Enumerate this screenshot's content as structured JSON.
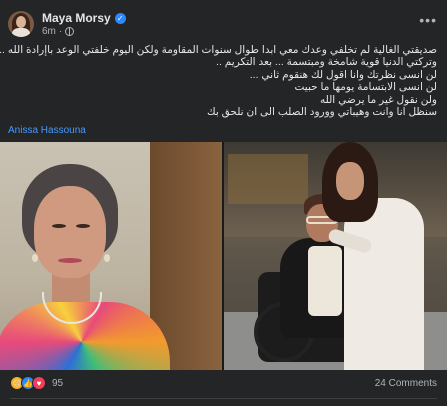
{
  "post": {
    "author": "Maya Morsy",
    "time": "6m",
    "text_lines": [
      "صديقتي الغالية لم تخلفي وعدك معي  ابدا طوال سنوات المقاومة ولكن اليوم خلفتي الوعد باإرادة الله ...",
      "وتركتي الدنيا قوية شامخة ومبتسمة ... بعد التكريم ..",
      "لن انسى نظرتك وانا اقول لك هنقوم ثاني ...",
      "لن انسى الابتسامة يومها ما حبيت",
      "ولن نقول غير ما يرضي الله",
      "سنظل انا وانت وهيباتي وورود الصلب الى ان نلحق بك"
    ],
    "tagged": "Anissa Hassouna"
  },
  "reactions": {
    "count": "95",
    "comments": "24 Comments",
    "types": [
      "sad",
      "like",
      "love"
    ]
  },
  "icons": {
    "verified": "verified-badge-icon",
    "globe": "public-globe-icon",
    "more": "more-options-icon"
  },
  "colors": {
    "background": "#242526",
    "link": "#4599ff",
    "verified": "#2d88ff",
    "love": "#f33e58",
    "sad": "#f7b125"
  }
}
